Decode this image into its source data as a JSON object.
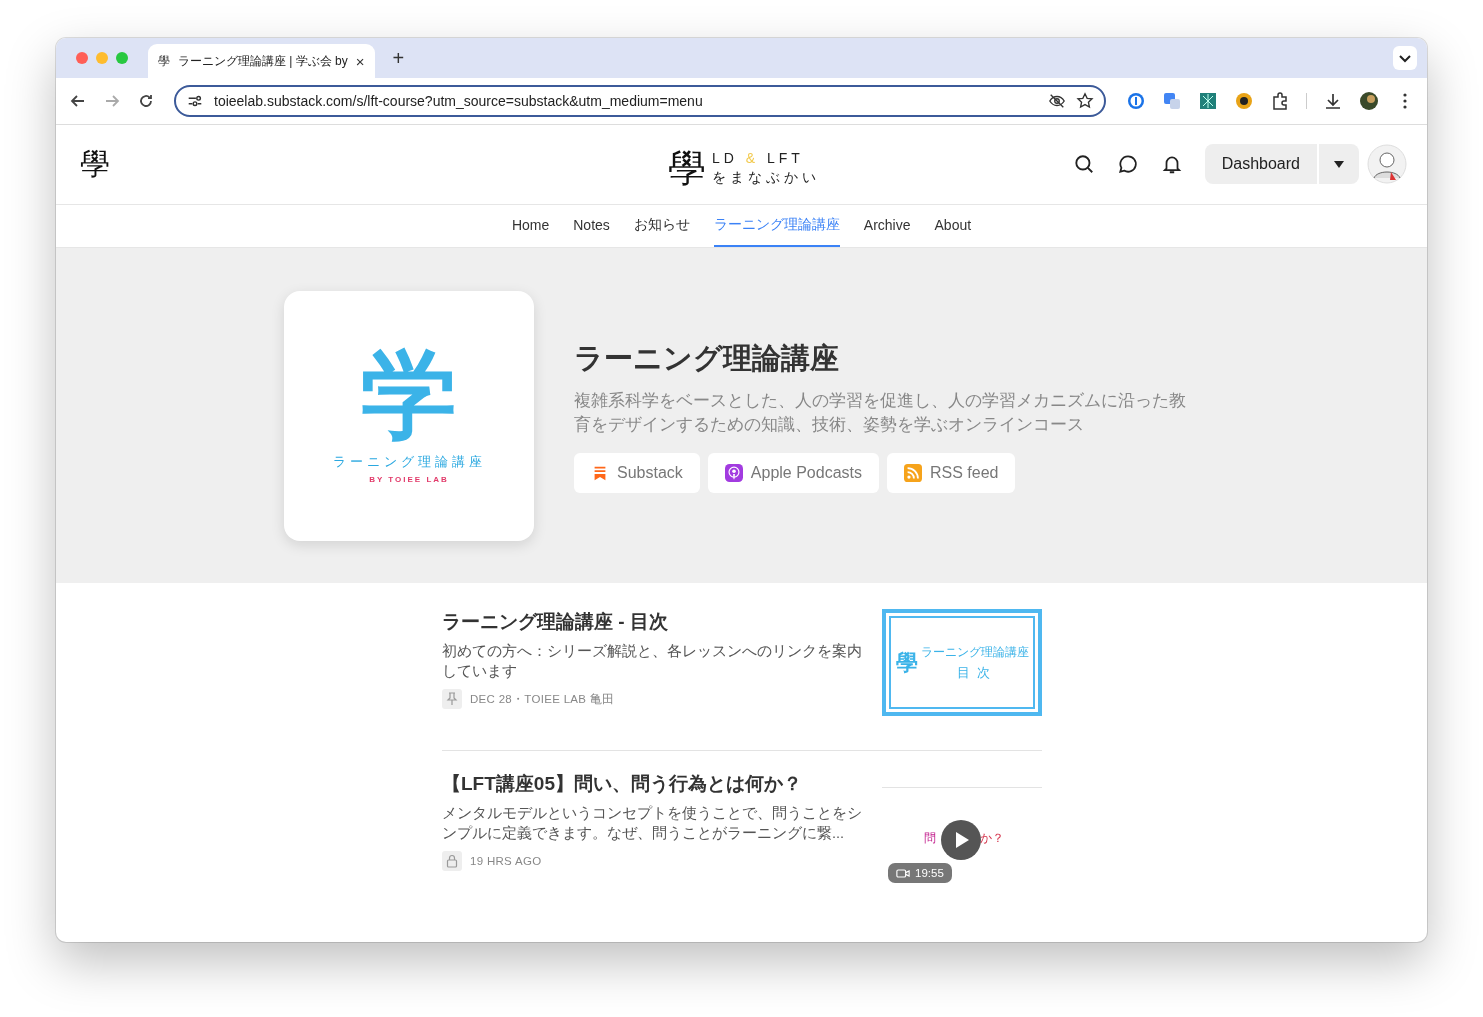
{
  "browser": {
    "favicon": "學",
    "tab_title": "ラーニング理論講座 | 学ぶ会 by",
    "tab_close": "×",
    "new_tab": "+",
    "url": "toieelab.substack.com/s/lft-course?utm_source=substack&utm_medium=menu"
  },
  "header": {
    "mark": "學",
    "brand": {
      "mark": "學",
      "left": "LD",
      "amp": "&",
      "right": "LFT",
      "sub": "をまなぶかい"
    },
    "dashboard": "Dashboard"
  },
  "nav": [
    {
      "label": "Home",
      "selected": false
    },
    {
      "label": "Notes",
      "selected": false
    },
    {
      "label": "お知らせ",
      "selected": false
    },
    {
      "label": "ラーニング理論講座",
      "selected": true
    },
    {
      "label": "Archive",
      "selected": false
    },
    {
      "label": "About",
      "selected": false
    }
  ],
  "hero": {
    "cover": {
      "mark": "学",
      "title": "ラーニング理論講座",
      "byline": "BY TOIEE LAB"
    },
    "title": "ラーニング理論講座",
    "description": "複雑系科学をベースとした、人の学習を促進し、人の学習メカニズムに沿った教育をデザインするための知識、技術、姿勢を学ぶオンラインコース",
    "buttons": [
      {
        "label": "Substack",
        "kind": "substack"
      },
      {
        "label": "Apple Podcasts",
        "kind": "podcasts"
      },
      {
        "label": "RSS feed",
        "kind": "rss"
      }
    ]
  },
  "posts": [
    {
      "title": "ラーニング理論講座 - 目次",
      "subtitle": "初めての方へ：シリーズ解説と、各レッスンへのリンクを案内しています",
      "kind": "pinned",
      "meta": "DEC 28・TOIEE LAB 亀田",
      "thumb": {
        "kind": "toc",
        "mark": "學",
        "caption": "ラーニング理論講座",
        "heading": "目 次"
      }
    },
    {
      "title": "【LFT講座05】問い、問う行為とは何か？",
      "subtitle": "メンタルモデルというコンセプトを使うことで、問うことをシンプルに定義できます。なぜ、問うことがラーニングに繋...",
      "kind": "locked",
      "meta": "19 HRS AGO",
      "thumb": {
        "kind": "video",
        "left": "問",
        "right": "か？",
        "duration": "19:55"
      }
    }
  ]
}
